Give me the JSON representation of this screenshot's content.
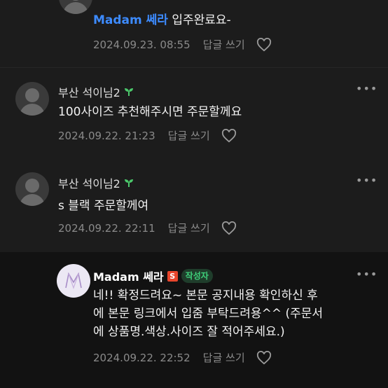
{
  "comments": [
    {
      "author": "",
      "mention": "Madam 쎄라",
      "text": " 입주완료요-",
      "date": "2024.09.23. 08:55",
      "reply_label": "답글 쓰기"
    },
    {
      "author": "부산 석이님2",
      "text": "100사이즈 추천해주시면 주문할께요",
      "date": "2024.09.22. 21:23",
      "reply_label": "답글 쓰기"
    },
    {
      "author": "부산 석이님2",
      "text": "s 블랙 주문할께여",
      "date": "2024.09.22. 22:11",
      "reply_label": "답글 쓰기"
    },
    {
      "author": "Madam 쎄라",
      "badge_s": "S",
      "author_badge": "작성자",
      "text_lines": [
        "네!! 확정드려요~ 본문 공지내용 확인하신 후",
        "에 본문 링크에서 입줌 부탁드려용^^ (주문서",
        "에 상품명.색상.사이즈 잘 적어주세요.)"
      ],
      "date": "2024.09.22. 22:52",
      "reply_label": "답글 쓰기"
    }
  ],
  "icons": {
    "more": "more-dots-icon",
    "like": "heart-icon",
    "level": "sprout-icon"
  },
  "colors": {
    "mention": "#3d8bff",
    "author_badge_text": "#3fcf7a",
    "s_badge": "#e8452c"
  }
}
